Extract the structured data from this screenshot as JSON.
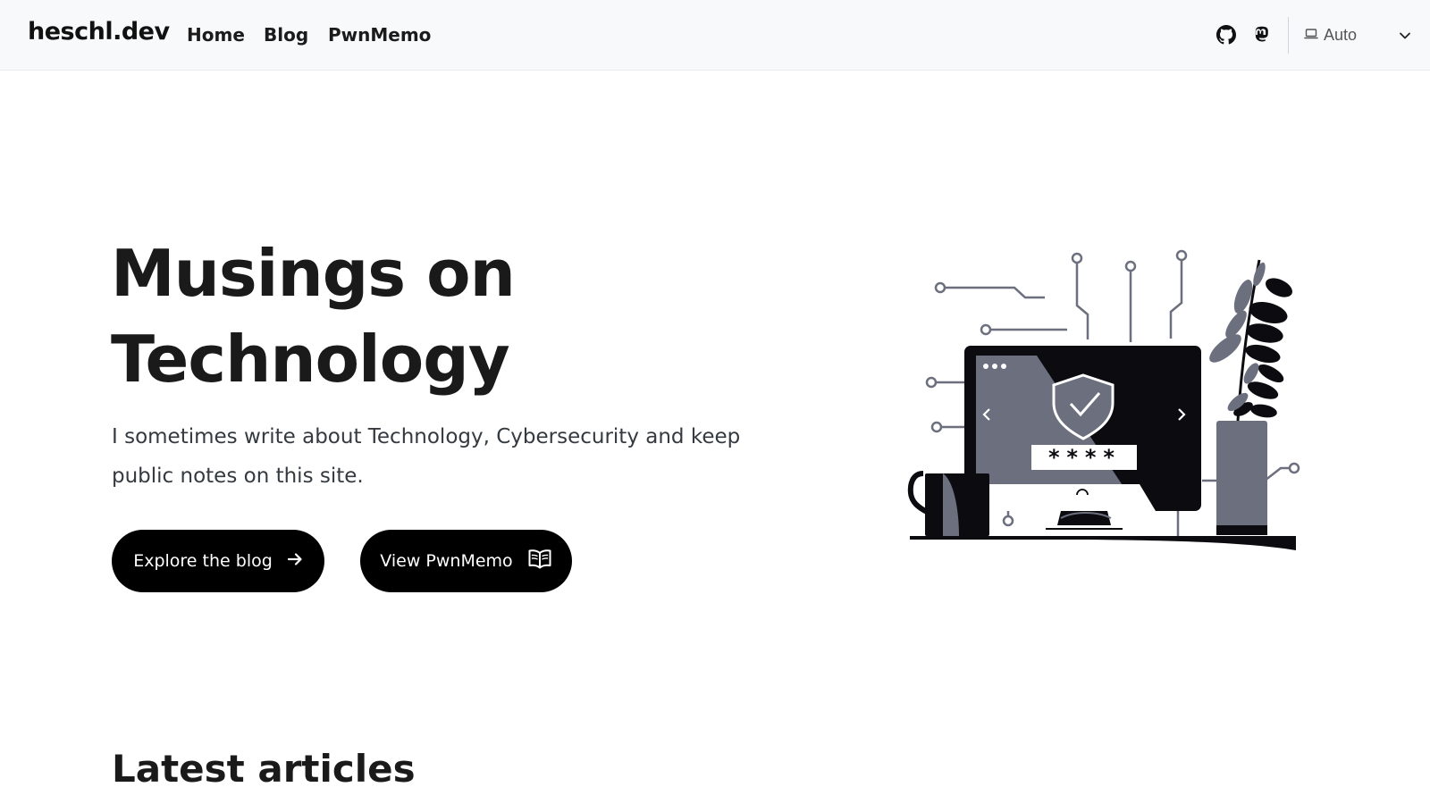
{
  "nav": {
    "brand": "heschl.dev",
    "links": [
      "Home",
      "Blog",
      "PwnMemo"
    ],
    "social_icons": [
      "github-icon",
      "mastodon-icon"
    ],
    "theme": {
      "label": "Auto",
      "icon": "laptop-icon",
      "caret": "chevron-down-icon"
    }
  },
  "hero": {
    "title_line1": "Musings on",
    "title_line2": "Technology",
    "description": "I sometimes write about Technology, Cybersecurity and keep public notes on this site.",
    "buttons": [
      {
        "label": "Explore the blog",
        "icon": "arrow-right-icon"
      },
      {
        "label": "View PwnMemo",
        "icon": "open-book-icon"
      }
    ],
    "illustration_password_mask": "****"
  },
  "section": {
    "latest_heading": "Latest articles"
  },
  "colors": {
    "primary": "#000000",
    "navbar_bg": "#f8f9fa",
    "text": "#212529",
    "illustration_gray": "#6c6f7d"
  }
}
